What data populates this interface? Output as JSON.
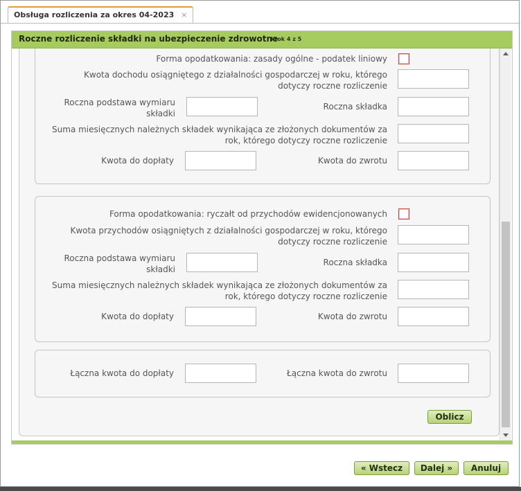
{
  "tab": {
    "label": "Obsługa rozliczenia za okres 04-2023",
    "close": "×"
  },
  "panel": {
    "title": "Roczne rozliczenie składki na ubezpieczenie zdrowotne",
    "step": "krok 4 z 5"
  },
  "section1": {
    "form_label": "Forma opodatkowania: zasady ogólne - podatek liniowy",
    "income_label": "Kwota dochodu osiągniętego z działalności gospodarczej w roku, którego dotyczy roczne rozliczenie",
    "base_label": "Roczna podstawa wymiaru składki",
    "annual_contribution_label": "Roczna składka",
    "monthly_sum_label": "Suma miesięcznych należnych składek wynikająca ze złożonych dokumentów za rok, którego dotyczy roczne rozliczenie",
    "surcharge_label": "Kwota do dopłaty",
    "refund_label": "Kwota do zwrotu"
  },
  "section2": {
    "form_label": "Forma opodatkowania: ryczałt od przychodów ewidencjonowanych",
    "revenue_label": "Kwota przychodów osiągniętych z działalności gospodarczej w roku, którego dotyczy roczne rozliczenie",
    "base_label": "Roczna podstawa wymiaru składki",
    "annual_contribution_label": "Roczna składka",
    "monthly_sum_label": "Suma miesięcznych należnych składek wynikająca ze złożonych dokumentów za rok, którego dotyczy roczne rozliczenie",
    "surcharge_label": "Kwota do dopłaty",
    "refund_label": "Kwota do zwrotu"
  },
  "section3": {
    "total_surcharge_label": "Łączna kwota do dopłaty",
    "total_refund_label": "Łączna kwota do zwrotu"
  },
  "buttons": {
    "calculate": "Oblicz",
    "back": "« Wstecz",
    "next": "Dalej »",
    "cancel": "Anuluj"
  }
}
